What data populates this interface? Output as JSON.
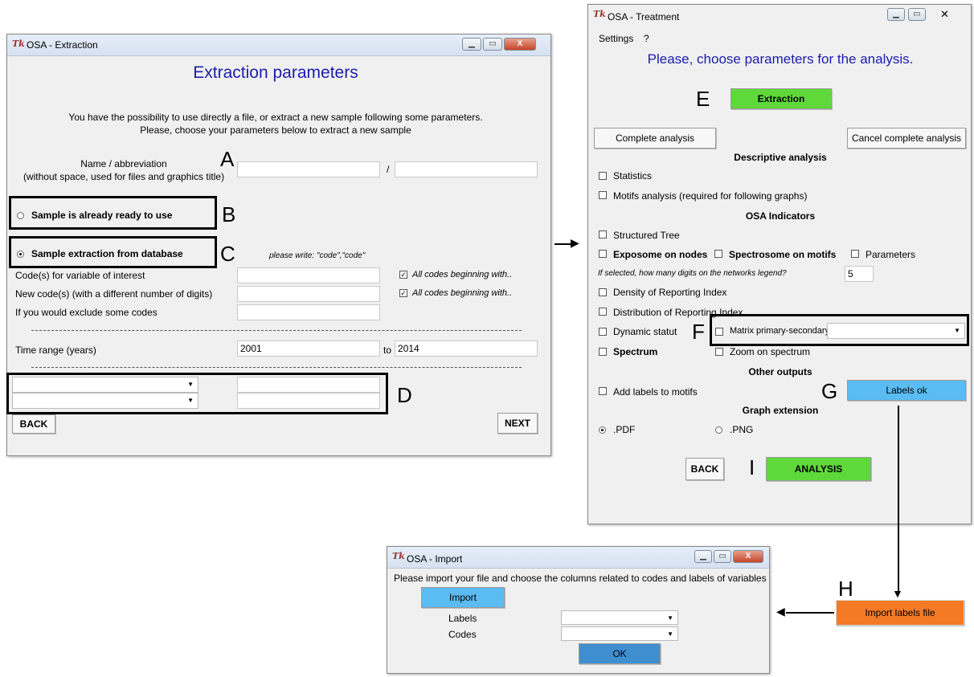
{
  "extraction": {
    "title": "OSA - Extraction",
    "heading": "Extraction parameters",
    "intro1": "You have the possibility to use directly a file, or extract a new sample following some parameters.",
    "intro2": "Please, choose your parameters below to extract a new sample",
    "name_label1": "Name / abbreviation",
    "name_label2": "(without space, used for files and graphics title)",
    "slash": "/",
    "radio_ready": "Sample is already ready to use",
    "radio_db": "Sample extraction from database",
    "hint": "please write: \"code\",\"code\"",
    "code_interest": "Code(s) for variable of interest",
    "new_codes": "New code(s) (with a different number of digits)",
    "exclude": "If you would exclude some codes",
    "all_codes": "All codes beginning with..",
    "time_range": "Time range (years)",
    "year_from": "2001",
    "to": "to",
    "year_to": "2014",
    "back": "BACK",
    "next": "NEXT"
  },
  "treatment": {
    "title": "OSA - Treatment",
    "menu": [
      "Settings",
      "?"
    ],
    "heading": "Please, choose parameters for the analysis.",
    "extraction_btn": "Extraction",
    "complete": "Complete analysis",
    "cancel_complete": "Cancel complete analysis",
    "desc_heading": "Descriptive analysis",
    "statistics": "Statistics",
    "motifs": "Motifs analysis (required for following graphs)",
    "osa_heading": "OSA Indicators",
    "structured_tree": "Structured Tree",
    "exposome": "Exposome on nodes",
    "spectrosome": "Spectrosome on motifs",
    "parameters": "Parameters",
    "digits_q": "If selected, how many digits on the networks legend?",
    "digits_val": "5",
    "density": "Density of Reporting Index",
    "distribution": "Distribution of Reporting Index",
    "dynamic": "Dynamic statut",
    "matrix": "Matrix primary-secondary:",
    "spectrum": "Spectrum",
    "zoom": "Zoom on spectrum",
    "other_heading": "Other outputs",
    "add_labels": "Add labels to motifs",
    "labels_ok": "Labels ok",
    "graph_heading": "Graph extension",
    "pdf": ".PDF",
    "png": ".PNG",
    "back": "BACK",
    "analysis": "ANALYSIS"
  },
  "import": {
    "title": "OSA - Import",
    "instruction": "Please import your file and choose the columns related to codes and labels of variables",
    "import_btn": "Import",
    "labels": "Labels",
    "codes": "Codes",
    "ok": "OK"
  },
  "import_labels_file": "Import labels file",
  "markers": {
    "A": "A",
    "B": "B",
    "C": "C",
    "D": "D",
    "E": "E",
    "F": "F",
    "G": "G",
    "H": "H",
    "I": "I"
  },
  "colors": {
    "green": "#5fd93a",
    "blue_btn": "#5bbcf4",
    "orange": "#f47a26",
    "ok_btn": "#3f8fd0",
    "heading_blue": "#1b1bb0"
  }
}
